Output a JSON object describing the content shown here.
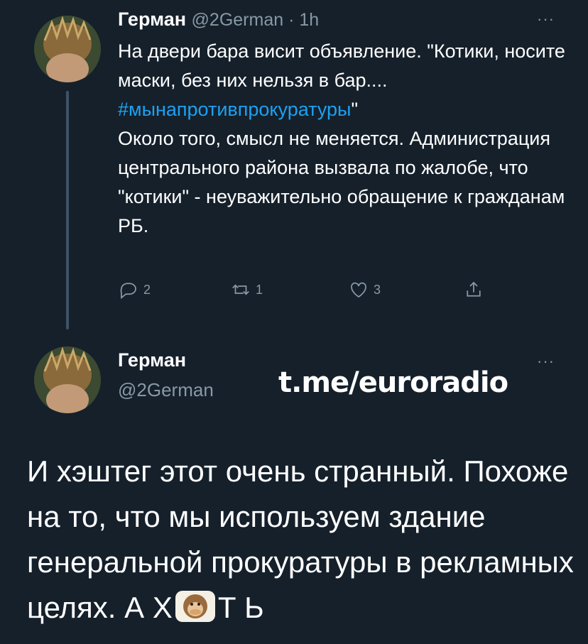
{
  "tweet1": {
    "author_name": "Герман",
    "meta": "@2German · 1h",
    "more": "···",
    "text_before_hashtag": "На двери бара висит объявление. \"Котики, носите маски, без них нельзя в бар.... ",
    "hashtag": "#мынапротивпрокуратуры",
    "text_after_hashtag": "\"\nОколо того, смысл не меняется. Администрация центрального района вызвала по жалобе, что \"котики\" - неуважительно обращение к гражданам РБ.",
    "actions": {
      "reply_count": "2",
      "retweet_count": "1",
      "like_count": "3"
    }
  },
  "tweet2": {
    "author_name": "Герман",
    "handle": "@2German",
    "more": "···",
    "text_part1": "И хэштег этот очень странный. Похоже на то, что мы используем здание генеральной прокуратуры в рекламных целях. А Х",
    "emoji_name": "speak-no-evil-monkey-icon",
    "text_part2": "Т Ь"
  },
  "watermark": "t.me/euroradio",
  "colors": {
    "background": "#15202b",
    "text": "#ffffff",
    "muted": "#8899a6",
    "link": "#1da1f2",
    "thread_line": "#3d5466"
  }
}
